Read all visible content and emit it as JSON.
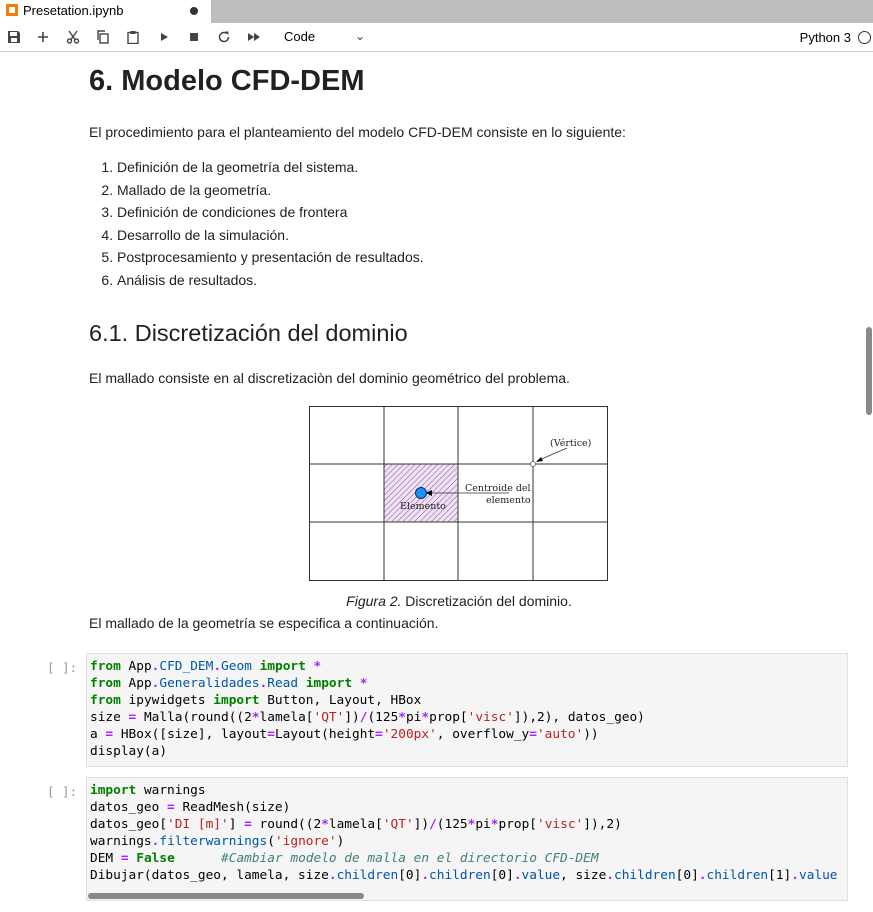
{
  "tab": {
    "title": "Presetation.ipynb"
  },
  "toolbar": {
    "cell_type": "Code",
    "kernel": "Python 3"
  },
  "notebook": {
    "heading1": "6. Modelo CFD-DEM",
    "intro": "El procedimiento para el planteamiento del modelo CFD-DEM consiste en lo siguiente:",
    "steps": [
      "Definición de la geometría del sistema.",
      "Mallado de la geometría.",
      "Definición de condiciones de frontera",
      "Desarrollo de la simulación.",
      "Postprocesamiento y presentación de resultados.",
      "Análisis de resultados."
    ],
    "heading2": "6.1. Discretización del dominio",
    "mesh_text": "El mallado consiste en al discretizaciòn del dominio geométrico del problema.",
    "figure": {
      "vertex_label": "(Vértice)",
      "centroid_label_1": "Centroide del",
      "centroid_label_2": "elemento",
      "element_label": "Elemento",
      "caption_em": "Figura 2.",
      "caption_text": " Discretización del dominio."
    },
    "after_figure": "El mallado de la geometría se especifica a continuación.",
    "cells": [
      {
        "prompt": "[ ]:"
      },
      {
        "prompt": "[ ]:"
      }
    ]
  }
}
